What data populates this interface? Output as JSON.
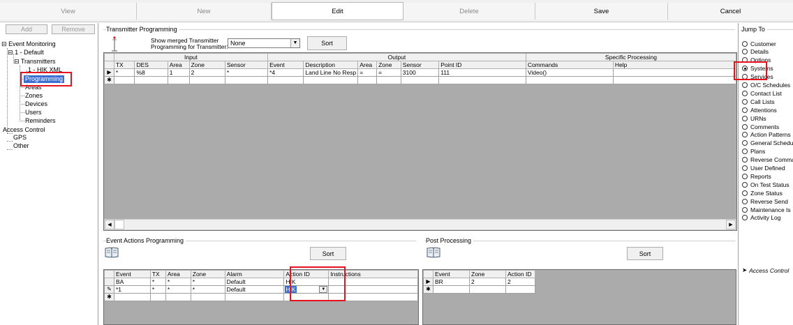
{
  "toolbar": {
    "view": "View",
    "new": "New",
    "edit": "Edit",
    "delete": "Delete",
    "save": "Save",
    "cancel": "Cancel"
  },
  "tree": {
    "add_label": "Add",
    "remove_label": "Remove",
    "items": {
      "event_monitoring": "Event Monitoring",
      "default": "1 - Default",
      "transmitters": "Transmitters",
      "hik_xml": "1 - HIK XML",
      "programming": "Programming",
      "areas": "Areas",
      "zones": "Zones",
      "devices": "Devices",
      "users": "Users",
      "reminders": "Reminders",
      "access_control": "Access Control",
      "gps": "GPS",
      "other": "Other"
    }
  },
  "transmitter": {
    "section_title": "Transmitter Programming",
    "merged_label_1": "Show merged Transmitter",
    "merged_label_2": "Programming for Transmitter:",
    "merged_value": "None",
    "sort_label": "Sort",
    "group_headers": {
      "input": "Input",
      "output": "Output",
      "specific": "Specific Processing"
    },
    "columns": [
      "TX",
      "DES",
      "Area",
      "Zone",
      "Sensor",
      "Event",
      "Description",
      "Area",
      "Zone",
      "Sensor",
      "Point ID",
      "Commands",
      "Help"
    ],
    "rows": [
      [
        "*",
        "%8",
        "1",
        "2",
        "*",
        "*4",
        "Land Line No Resp",
        "=",
        "=",
        "3100",
        "111",
        "Video()",
        ""
      ]
    ]
  },
  "event_actions": {
    "section_title": "Event Actions Programming",
    "sort_label": "Sort",
    "columns": [
      "Event",
      "TX",
      "Area",
      "Zone",
      "Alarm",
      "Action ID",
      "Instructions"
    ],
    "rows": [
      [
        "BA",
        "*",
        "*",
        "*",
        "Default",
        "HIK",
        ""
      ],
      [
        "*1",
        "*",
        "*",
        "*",
        "Default",
        "HIK",
        ""
      ]
    ]
  },
  "post_processing": {
    "section_title": "Post Processing",
    "sort_label": "Sort",
    "columns": [
      "Event",
      "Zone",
      "Action ID"
    ],
    "rows": [
      [
        "BR",
        "2",
        "2"
      ]
    ]
  },
  "jump_to": {
    "title": "Jump To",
    "selected": "Systems",
    "items": [
      "Customer",
      "Details",
      "Options",
      "Systems",
      "Services",
      "O/C Schedules",
      "Contact List",
      "Call Lists",
      "Attentions",
      "URNs",
      "Comments",
      "Action Patterns",
      "General Schedu",
      "Plans",
      "Reverse Comma",
      "User Defined",
      "Reports",
      "On Test Status",
      "Zone Status",
      "Reverse Send",
      "Maintenance Is",
      "Activity Log"
    ],
    "access_control": "Access Control"
  },
  "colors": {
    "highlight_box": "#e8121c",
    "selection": "#3d6fd1"
  },
  "icons": {
    "row_pointer": "row-pointer-icon",
    "new_row": "new-row-asterisk-icon",
    "edit_row": "pencil-edit-icon",
    "book": "book-icon",
    "transmitter": "antenna-icon"
  }
}
